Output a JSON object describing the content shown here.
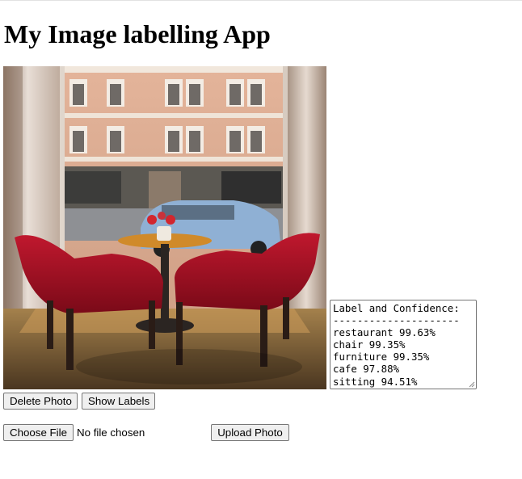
{
  "page": {
    "title": "My Image labelling App"
  },
  "photo": {
    "description_icon": "cafe-window-photo"
  },
  "labels": {
    "header": "Label and Confidence:",
    "separator": "---------------------",
    "items": [
      {
        "label": "restaurant",
        "confidence": "99.63%"
      },
      {
        "label": "chair",
        "confidence": "99.35%"
      },
      {
        "label": "furniture",
        "confidence": "99.35%"
      },
      {
        "label": "cafe",
        "confidence": "97.88%"
      },
      {
        "label": "sitting",
        "confidence": "94.51%"
      }
    ]
  },
  "actions": {
    "delete_label": "Delete Photo",
    "show_labels_label": "Show Labels"
  },
  "upload": {
    "choose_file_label": "Choose File",
    "file_status": "No file chosen",
    "upload_label": "Upload Photo"
  }
}
